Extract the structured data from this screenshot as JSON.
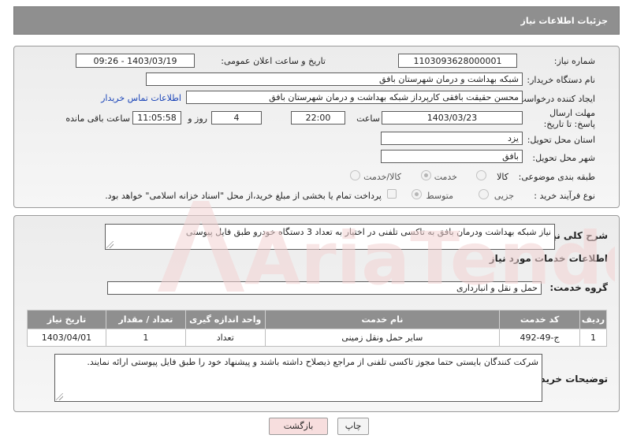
{
  "page_title": "جزئیات اطلاعات نیاز",
  "fields": {
    "need_number": {
      "label": "شماره نیاز:",
      "value": "1103093628000001"
    },
    "announce_datetime": {
      "label": "تاریخ و ساعت اعلان عمومی:",
      "value": "1403/03/19 - 09:26"
    },
    "buyer_org": {
      "label": "نام دستگاه خریدار:",
      "value": "شبکه بهداشت و درمان شهرستان بافق"
    },
    "requester": {
      "label": "ایجاد کننده درخواست:",
      "value": "محسن حقیقت بافقی کارپرداز شبکه بهداشت و درمان شهرستان بافق"
    },
    "buyer_contact_link": "اطلاعات تماس خریدار",
    "deadline": {
      "label": "مهلت ارسال پاسخ: تا تاریخ:",
      "date": "1403/03/23",
      "time_label": "ساعت",
      "time": "22:00",
      "days": "4",
      "days_label": "روز و",
      "remaining": "11:05:58",
      "remaining_label": "ساعت باقی مانده"
    },
    "province": {
      "label": "استان محل تحویل:",
      "value": "یزد"
    },
    "city": {
      "label": "شهر محل تحویل:",
      "value": "بافق"
    },
    "category": {
      "label": "طبقه بندی موضوعی:",
      "options": [
        "کالا",
        "خدمت",
        "کالا/خدمت"
      ],
      "selected": "خدمت"
    },
    "process_type": {
      "label": "نوع فرآیند خرید :",
      "options": [
        "جزیی",
        "متوسط"
      ],
      "selected": "متوسط",
      "payment_note": "پرداخت تمام یا بخشی از مبلغ خرید،از محل \"اسناد خزانه اسلامی\" خواهد بود."
    }
  },
  "summary": {
    "label": "شرح کلی نیاز:",
    "value": "نیاز شبکه بهداشت ودرمان بافق به تاکسی تلفنی در اختیار به تعداد 3 دستگاه خودرو طبق فایل پیوستی"
  },
  "services": {
    "section_title": "اطلاعات خدمات مورد نیاز",
    "group_label": "گروه خدمت:",
    "group_value": "حمل و نقل و انبارداری",
    "columns": [
      "ردیف",
      "کد خدمت",
      "نام خدمت",
      "واحد اندازه گیری",
      "تعداد / مقدار",
      "تاریخ نیاز"
    ],
    "rows": [
      [
        "1",
        "ج-49-492",
        "سایر حمل ونقل زمینی",
        "تعداد",
        "1",
        "1403/04/01"
      ]
    ]
  },
  "buyer_notes": {
    "label": "توضیحات خریدار:",
    "value": "شرکت کنندگان بایستی حتما مجوز تاکسی تلفنی از مراجع ذیصلاح داشته باشند و پیشنهاد خود را طبق فایل پیوستی ارائه نمایند."
  },
  "buttons": {
    "print": "چاپ",
    "back": "بازگشت"
  },
  "watermark": {
    "text": "AriaTender.neT"
  },
  "colors": {
    "header": "#8f8f8f",
    "back_button": "#f7dede",
    "watermark": "#f3d3d3"
  }
}
